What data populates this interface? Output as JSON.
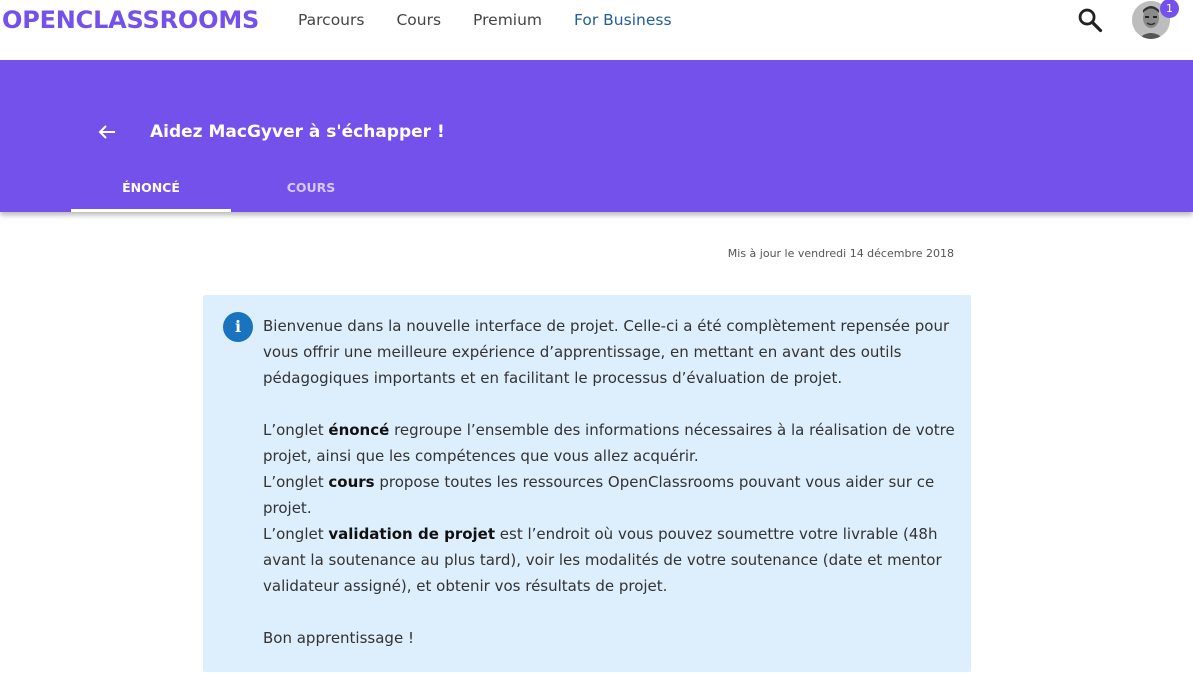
{
  "brand": {
    "logo_text": "OPENCLASSROOMS",
    "color": "#7451eb"
  },
  "nav": {
    "links": [
      {
        "label": "Parcours"
      },
      {
        "label": "Cours"
      },
      {
        "label": "Premium"
      },
      {
        "label": "For Business"
      }
    ],
    "search_icon": "search-icon",
    "notification_count": "1"
  },
  "header": {
    "back_icon": "arrow-left-icon",
    "title": "Aidez MacGyver à s'échapper !",
    "tabs": [
      {
        "label": "ÉNONCÉ",
        "active": true
      },
      {
        "label": "COURS",
        "active": false
      }
    ]
  },
  "updated_text": "Mis à jour le vendredi 14 décembre 2018",
  "info": {
    "icon": "info-icon",
    "icon_glyph": "i",
    "intro": "Bienvenue dans la nouvelle interface de projet. Celle-ci a été complètement repensée pour vous offrir une meilleure expérience d’apprentissage, en mettant en avant des outils pédagogiques importants et en facilitant le processus d’évaluation de projet.",
    "items": [
      {
        "prefix": "L’onglet ",
        "term": "énoncé",
        "text": " regroupe l’ensemble des informations nécessaires à la réalisation de votre projet, ainsi que les compétences que vous allez acquérir."
      },
      {
        "prefix": "L’onglet ",
        "term": "cours",
        "text": " propose toutes les ressources OpenClassrooms pouvant vous aider sur ce projet."
      },
      {
        "prefix": "L’onglet ",
        "term": "validation de projet",
        "text": " est l’endroit où vous pouvez soumettre votre livrable (48h avant la soutenance au plus tard), voir les modalités de votre soutenance (date et mentor validateur assigné), et obtenir vos résultats de projet."
      }
    ],
    "closing": "Bon apprentissage !"
  }
}
